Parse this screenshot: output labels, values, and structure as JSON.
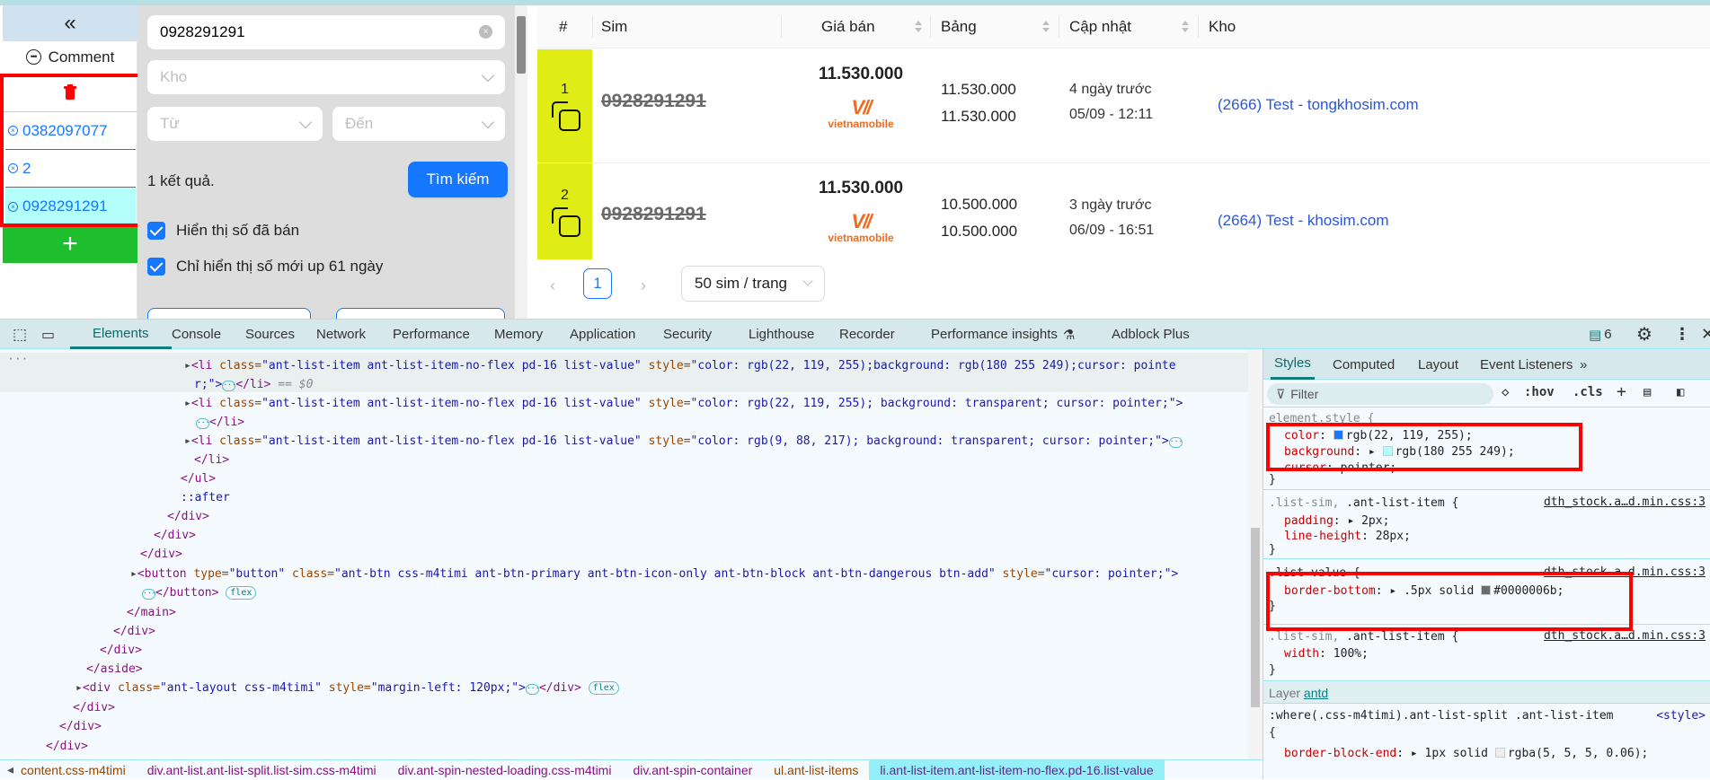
{
  "sidebar": {
    "collapse_icon": "double-chevron-left-icon",
    "collapse_glyph": "«",
    "comment_label": "Comment",
    "comment_icon": "comment-icon",
    "delete_icon": "trash-icon",
    "items": [
      {
        "label": "0382097077",
        "selected": false
      },
      {
        "label": "2",
        "selected": false
      },
      {
        "label": "0928291291",
        "selected": true
      }
    ],
    "remove_glyph": "×",
    "add_glyph": "+",
    "selected_bg": "#b4fff9",
    "item_color": "#1677ff",
    "add_bg": "#1ebe2e"
  },
  "filter": {
    "search_value": "0928291291",
    "warehouse_placeholder": "Kho",
    "from_placeholder": "Từ",
    "to_placeholder": "Đến",
    "result_text": "1 kết quả.",
    "search_button": "Tìm kiếm",
    "checkboxes": [
      {
        "label": "Hiển thị số đã bán",
        "checked": true
      },
      {
        "label": "Chỉ hiển thị số mới up 61 ngày",
        "checked": true
      }
    ]
  },
  "table": {
    "columns": [
      "#",
      "Sim",
      "Giá bán",
      "Bảng",
      "Cập nhật",
      "Kho"
    ],
    "rows": [
      {
        "index": "1",
        "sim": "0928291291",
        "price": "11.530.000",
        "carrier": "vietnamobile",
        "carrier_mark": "V//",
        "bang1": "11.530.000",
        "bang2": "11.530.000",
        "updated_rel": "4 ngày trước",
        "updated_at": "05/09 - 12:11",
        "warehouse": "(2666) Test - tongkhosim.com"
      },
      {
        "index": "2",
        "sim": "0928291291",
        "price": "11.530.000",
        "carrier": "vietnamobile",
        "carrier_mark": "V//",
        "bang1": "10.500.000",
        "bang2": "10.500.000",
        "updated_rel": "3 ngày trước",
        "updated_at": "06/09 - 16:51",
        "warehouse": "(2664) Test - khosim.com"
      }
    ],
    "pagination": {
      "prev": "‹",
      "current_page": "1",
      "next": "›",
      "page_size": "50 sim / trang"
    }
  },
  "devtools": {
    "tabs": [
      "Elements",
      "Console",
      "Sources",
      "Network",
      "Performance",
      "Memory",
      "Application",
      "Security",
      "Lighthouse",
      "Recorder",
      "Performance insights",
      "Adblock Plus"
    ],
    "active_tab": "Elements",
    "issues_count": "6",
    "elements_lines": {
      "l1_tag": "<li ",
      "l1_attr": "class=",
      "l1_val": "\"ant-list-item ant-list-item-no-flex pd-16 list-value\"",
      "l1_style_attr": " style=",
      "l1_style_val": "\"color: rgb(22, 119, 255);background: rgb(180 255 249);cursor: pointe",
      "l1b": "r;\">",
      "l1b_close": "</li>",
      "l1b_eq": " == $0",
      "l2_style_val": "\"color: rgb(22, 119, 255); background: transparent; cursor: pointer;\">",
      "l2b_close": "</li>",
      "l3_style_val": "\"color: rgb(9, 88, 217); background: transparent; cursor: pointer;\">",
      "l3b_close": "</li>",
      "ul_close": "</ul>",
      "after": "::after",
      "div_close": "</div>",
      "button_tag": "<button ",
      "button_type_attr": "type=",
      "button_type_val": "\"button\"",
      "button_class_attr": " class=",
      "button_class_val": "\"ant-btn css-m4timi ant-btn-primary ant-btn-icon-only ant-btn-block ant-btn-dangerous btn-add\"",
      "button_style_attr": " style=",
      "button_style_val": "\"cursor: pointer;\">",
      "button_close": "</button>",
      "flex_badge": "flex",
      "main_close": "</main>",
      "aside_close": "</aside>",
      "layout_tag": "<div ",
      "layout_class_attr": "class=",
      "layout_class_val": "\"ant-layout css-m4timi\"",
      "layout_style_attr": " style=",
      "layout_style_val": "\"margin-left: 120px;\">",
      "layout_close": "</div>"
    },
    "breadcrumbs": [
      "content.css-m4timi",
      "div.ant-list.ant-list-split.list-sim.css-m4timi",
      "div.ant-spin-nested-loading.css-m4timi",
      "div.ant-spin-container",
      "ul.ant-list-items",
      "li.ant-list-item.ant-list-item-no-flex.pd-16.list-value"
    ],
    "styles": {
      "tabs": [
        "Styles",
        "Computed",
        "Layout",
        "Event Listeners"
      ],
      "more": "»",
      "filter_placeholder": "Filter",
      "hov": ":hov",
      "cls": ".cls",
      "element_style_selector": "element.style {",
      "color_prop": "color",
      "color_val": "rgb(22, 119, 255);",
      "color_swatch": "#1677ff",
      "bg_prop": "background",
      "bg_val": "rgb(180 255 249);",
      "bg_swatch": "#b4fff9",
      "cursor_prop": "cursor",
      "cursor_val": "pointer;",
      "rule2_selector_dim": ".list-sim, ",
      "rule2_selector": ".ant-list-item {",
      "rule2_src": "dth_stock.a…d.min.css:3",
      "padding_prop": "padding",
      "padding_val": "2px;",
      "lineheight_prop": "line-height",
      "lineheight_val": "28px;",
      "rule3_selector": ".list-value {",
      "rule3_src": "dth_stock.a…d.min.css:3",
      "border_prop": "border-bottom",
      "border_val": ".5px solid ",
      "border_color": "#0000006b;",
      "rule4_selector_dim": ".list-sim, ",
      "rule4_selector": ".ant-list-item {",
      "rule4_src": "dth_stock.a…d.min.css:3",
      "width_prop": "width",
      "width_val": "100%;",
      "layer_label": "Layer ",
      "layer_link": "antd",
      "rule5_selector": ":where(.css-m4timi).ant-list-split .ant-list-item",
      "rule5_src": "<style>",
      "bbe_prop": "border-block-end",
      "bbe_val": "1px solid ",
      "bbe_color": "rgba(5, 5, 5, 0.06);",
      "close_brace": "}",
      "open_brace": "{"
    }
  }
}
